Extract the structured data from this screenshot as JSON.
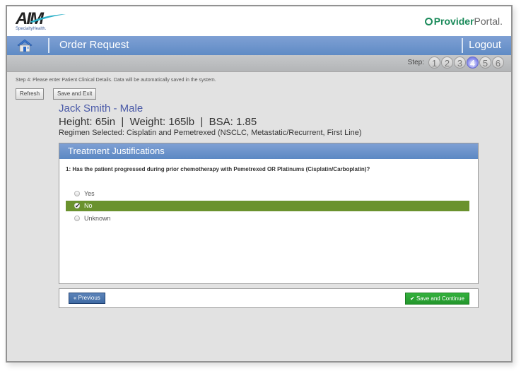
{
  "header": {
    "logo_text": "AIM",
    "logo_subtext": "SpecialtyHealth.",
    "portal_brand_bold": "Provider",
    "portal_brand_light": "Portal."
  },
  "nav": {
    "title": "Order Request",
    "logout_label": "Logout"
  },
  "steps": {
    "label": "Step:",
    "items": [
      "1",
      "2",
      "3",
      "4",
      "5",
      "6"
    ],
    "current": 4
  },
  "page": {
    "instructions": "Step 4: Please enter Patient Clinical Details. Data will be automatically saved in the system.",
    "refresh_label": "Refresh",
    "save_exit_label": "Save and Exit",
    "patient_name": "Jack Smith - Male",
    "vitals": "Height: 65in  |  Weight: 165lb  |  BSA: 1.85",
    "regimen": "Regimen Selected: Cisplatin and Pemetrexed (NSCLC, Metastatic/Recurrent, First Line)"
  },
  "panel": {
    "title": "Treatment Justifications",
    "question": "1: Has the patient progressed during prior chemotherapy with Pemetrexed OR Platinums (Cisplatin/Carboplatin)?",
    "options": [
      "Yes",
      "No",
      "Unknown"
    ],
    "selected": "No"
  },
  "footer": {
    "previous_label": "« Previous",
    "save_continue_label": "Save and Continue"
  },
  "colors": {
    "nav_blue": "#6a92cb",
    "selected_green": "#6a922e",
    "save_green": "#2aa234",
    "step_active": "#7a7ee6"
  }
}
